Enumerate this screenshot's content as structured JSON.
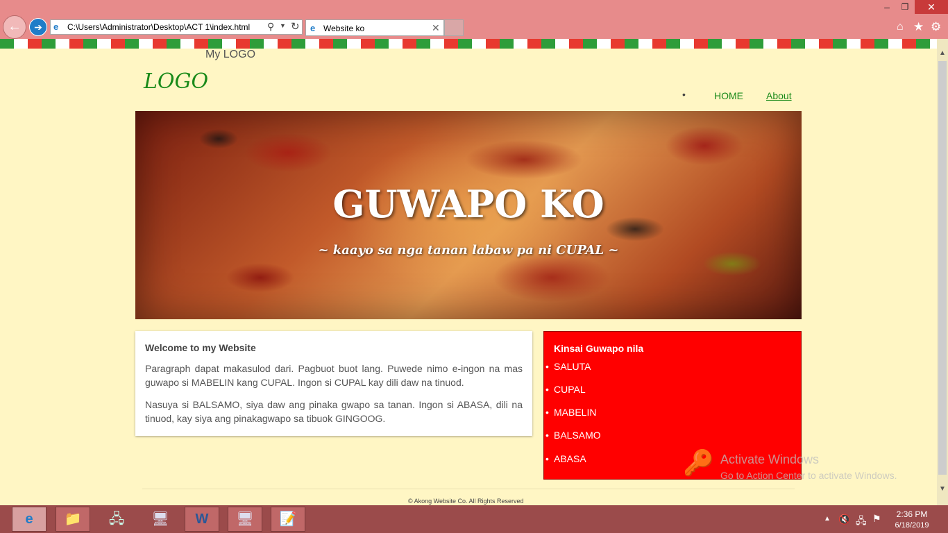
{
  "browser": {
    "address": "C:\\Users\\Administrator\\Desktop\\ACT 1\\index.html",
    "tab_title": "Website ko",
    "icons": [
      "back-icon",
      "forward-icon",
      "ie-icon",
      "search-icon",
      "dropdown-icon",
      "refresh-icon",
      "close-icon",
      "home-icon",
      "star-icon",
      "gear-icon"
    ]
  },
  "page": {
    "my_logo": "My LOGO",
    "logo": "LOGO",
    "nav": {
      "home": "HOME",
      "about": "About"
    },
    "hero": {
      "title": "GUWAPO KO",
      "subtitle": "~  kaayo sa nga tanan labaw pa ni CUPAL  ~"
    },
    "content": {
      "heading": "Welcome to my Website",
      "p1": "Paragraph dapat makasulod dari. Pagbuot buot lang. Puwede nimo e-ingon na mas guwapo si MABELIN kang CUPAL. Ingon si CUPAL kay dili daw na tinuod.",
      "p2": "Nasuya si BALSAMO, siya daw ang pinaka gwapo sa tanan. Ingon si ABASA, dili na tinuod, kay siya ang pinakagwapo sa tibuok GINGOOG."
    },
    "sidebar": {
      "heading": "Kinsai Guwapo nila",
      "items": [
        "SALUTA",
        "CUPAL",
        "MABELIN",
        "BALSAMO",
        "ABASA"
      ]
    },
    "footer": "© Akong Website Co. All Rights Reserved",
    "colors": {
      "background": "#fff6c4",
      "logo_green": "#1a8a1a",
      "sidebar_red": "#ff0000"
    }
  },
  "watermark": {
    "title": "Activate Windows",
    "subtitle": "Go to Action Center to activate Windows."
  },
  "taskbar": {
    "time": "2:36 PM",
    "date": "6/18/2019"
  }
}
